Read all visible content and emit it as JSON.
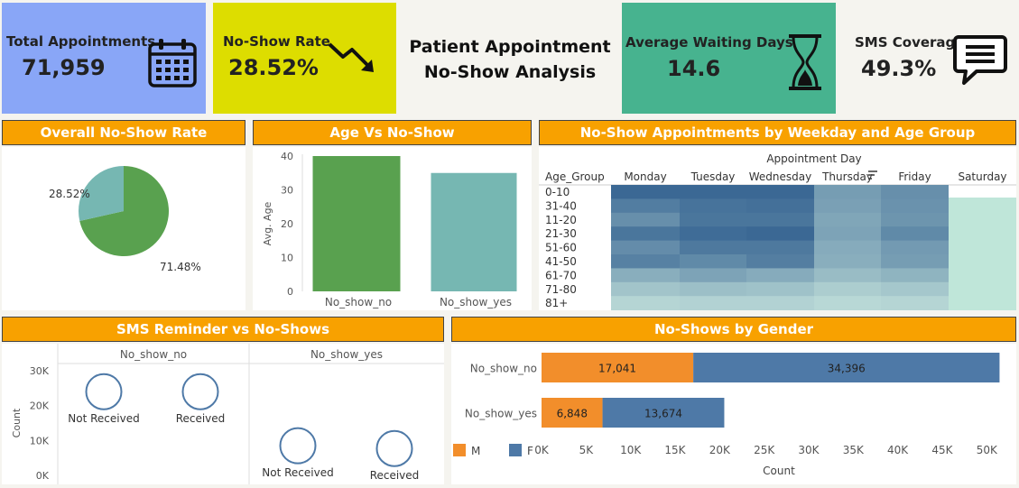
{
  "kpis": {
    "total": {
      "label": "Total Appointments",
      "value": "71,959",
      "icon": "calendar-icon",
      "color": "#89a6f7"
    },
    "noshow": {
      "label": "No-Show Rate",
      "value": "28.52%",
      "icon": "trend-down-icon",
      "color": "#dddd00"
    },
    "wait": {
      "label": "Average Waiting Days",
      "value": "14.6",
      "icon": "hourglass-icon",
      "color": "#47b38f"
    },
    "sms": {
      "label": "SMS Coverage",
      "value": "49.3%",
      "icon": "chat-icon",
      "color": "#ffffff"
    }
  },
  "dashboard_title_line1": "Patient Appointment",
  "dashboard_title_line2": "No-Show Analysis",
  "headers": {
    "pie": "Overall No-Show Rate",
    "age": "Age Vs No-Show",
    "heat": "No-Show Appointments by Weekday and Age Group",
    "sms": "SMS Reminder vs No-Shows",
    "gender": "No-Shows by Gender"
  },
  "chart_data": [
    {
      "id": "pie",
      "type": "pie",
      "title": "Overall No-Show Rate",
      "labels": [
        "71.48%",
        "28.52%"
      ],
      "values": [
        71.48,
        28.52
      ],
      "colors": [
        "#59a14f",
        "#76b7b2"
      ]
    },
    {
      "id": "age",
      "type": "bar",
      "title": "Age Vs No-Show",
      "categories": [
        "No_show_no",
        "No_show_yes"
      ],
      "values": [
        40,
        35
      ],
      "colors": [
        "#59a14f",
        "#76b7b2"
      ],
      "ylabel": "Avg. Age",
      "ylim": [
        0,
        40
      ],
      "yticks": [
        0,
        10,
        20,
        30,
        40
      ]
    },
    {
      "id": "heat",
      "type": "heatmap",
      "title": "No-Show Appointments by Weekday and Age Group",
      "xlabel": "Appointment Day",
      "rowheader": "Age_Group",
      "columns": [
        "Monday",
        "Tuesday",
        "Wednesday",
        "Thursday",
        "Friday",
        "Saturday"
      ],
      "rows": [
        "0-10",
        "31-40",
        "11-20",
        "21-30",
        "51-60",
        "41-50",
        "61-70",
        "71-80",
        "81+"
      ],
      "values": [
        [
          0.9,
          0.9,
          0.9,
          0.52,
          0.62,
          null
        ],
        [
          0.75,
          0.82,
          0.84,
          0.5,
          0.6,
          null
        ],
        [
          0.62,
          0.8,
          0.8,
          0.46,
          0.58,
          null
        ],
        [
          0.8,
          0.87,
          0.9,
          0.48,
          0.66,
          null
        ],
        [
          0.64,
          0.78,
          0.78,
          0.42,
          0.54,
          null
        ],
        [
          0.72,
          0.66,
          0.74,
          0.4,
          0.52,
          null
        ],
        [
          0.4,
          0.48,
          0.42,
          0.3,
          0.36,
          null
        ],
        [
          0.24,
          0.28,
          0.26,
          0.18,
          0.22,
          null
        ],
        [
          0.12,
          0.14,
          0.14,
          0.1,
          0.12,
          null
        ]
      ],
      "saturday_value": 0.02
    },
    {
      "id": "sms",
      "type": "scatter",
      "title": "SMS Reminder vs No-Shows",
      "panels": [
        "No_show_no",
        "No_show_yes"
      ],
      "ylabel": "Count",
      "ylim": [
        0,
        30000
      ],
      "yticks": [
        "0K",
        "10K",
        "20K",
        "30K"
      ],
      "points": [
        {
          "panel": "No_show_no",
          "label": "Not Received",
          "y": 24000
        },
        {
          "panel": "No_show_no",
          "label": "Received",
          "y": 24000
        },
        {
          "panel": "No_show_yes",
          "label": "Not Received",
          "y": 8500
        },
        {
          "panel": "No_show_yes",
          "label": "Received",
          "y": 7700
        }
      ]
    },
    {
      "id": "gender",
      "type": "bar",
      "title": "No-Shows by Gender",
      "orientation": "horizontal",
      "stacked": true,
      "categories": [
        "No_show_no",
        "No_show_yes"
      ],
      "series": [
        {
          "name": "M",
          "values": [
            17041,
            6848
          ],
          "labels": [
            "17,041",
            "6,848"
          ],
          "color": "#f28e2b"
        },
        {
          "name": "F",
          "values": [
            34396,
            13674
          ],
          "labels": [
            "34,396",
            "13,674"
          ],
          "color": "#4e79a7"
        }
      ],
      "xlabel": "Count",
      "xlim": [
        0,
        52000
      ],
      "xticks": [
        "0K",
        "5K",
        "10K",
        "15K",
        "20K",
        "25K",
        "30K",
        "35K",
        "40K",
        "45K",
        "50K"
      ]
    }
  ]
}
